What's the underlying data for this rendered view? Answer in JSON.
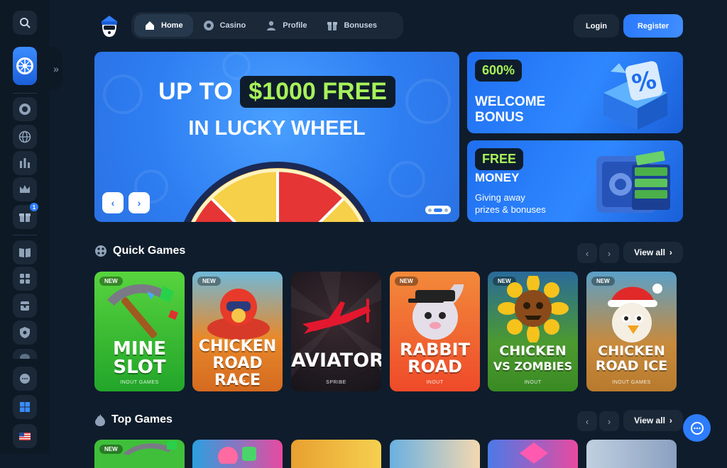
{
  "nav": {
    "items": [
      {
        "label": "Home",
        "icon": "home-icon",
        "active": true
      },
      {
        "label": "Casino",
        "icon": "chip-icon",
        "active": false
      },
      {
        "label": "Profile",
        "icon": "user-icon",
        "active": false
      },
      {
        "label": "Bonuses",
        "icon": "gift-icon",
        "active": false
      }
    ],
    "login": "Login",
    "register": "Register"
  },
  "sidebar": {
    "badge_count": "1",
    "icons": [
      "search-icon",
      "lucky-wheel-icon",
      "chip-icon",
      "globe-icon",
      "stats-icon",
      "crown-icon",
      "gift-icon",
      "book-icon",
      "games-icon",
      "chest-icon",
      "shield-icon",
      "cloud-icon",
      "chat-bubbles-icon",
      "windows-icon",
      "us-flag-icon"
    ]
  },
  "hero": {
    "line1_prefix": "UP TO",
    "line1_highlight": "$1000 FREE",
    "line2": "IN LUCKY WHEEL"
  },
  "promos": [
    {
      "pill": "600%",
      "title_l1": "WELCOME",
      "title_l2": "BONUS"
    },
    {
      "pill": "FREE",
      "title": "MONEY",
      "desc_l1": "Giving away",
      "desc_l2": "prizes & bonuses"
    }
  ],
  "quick_games": {
    "title": "Quick Games",
    "view_all": "View all",
    "games": [
      {
        "name_l1": "MINE",
        "name_l2": "SLOT",
        "provider": "INOUT GAMES",
        "is_new": true,
        "new_label": "NEW",
        "bg": "#3fbf3a"
      },
      {
        "name_l1": "CHICKEN",
        "name_l2": "ROAD RACE",
        "provider": "INOUT",
        "is_new": true,
        "new_label": "NEW",
        "bg": "#e8892b"
      },
      {
        "name_l1": "AVIATOR",
        "name_l2": "",
        "provider": "SPRIBE",
        "is_new": false,
        "new_label": "",
        "bg": "#1c1a1f"
      },
      {
        "name_l1": "RABBIT",
        "name_l2": "ROAD",
        "provider": "INOUT",
        "is_new": true,
        "new_label": "NEW",
        "bg": "#f0612f"
      },
      {
        "name_l1": "CHICKEN",
        "name_l2": "VS ZOMBIES",
        "provider": "INOUT",
        "is_new": true,
        "new_label": "NEW",
        "bg": "#4c9a2f"
      },
      {
        "name_l1": "CHICKEN",
        "name_l2": "ROAD ICE",
        "provider": "INOUT GAMES",
        "is_new": true,
        "new_label": "NEW",
        "bg": "#c88a3c"
      }
    ]
  },
  "top_games": {
    "title": "Top Games",
    "view_all": "View all",
    "new_label": "NEW"
  }
}
